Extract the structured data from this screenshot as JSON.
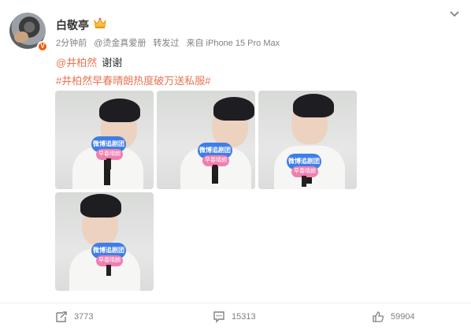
{
  "post": {
    "author": "白敬亭",
    "meta": {
      "time": "2分钟前",
      "source": "@烫金真爱册",
      "repost": "转发过",
      "device": "来自 iPhone 15 Pro Max"
    },
    "text_line1": {
      "mention": "@井柏然",
      "text": "谢谢"
    },
    "hashtag": "#井柏然早春晴朗热度破万送私服#",
    "photos": [
      {
        "sign": "微博追剧团",
        "sign2": "早春晴朗"
      },
      {
        "sign": "微博追剧团",
        "sign2": "早春晴朗"
      },
      {
        "sign": "微博追剧团",
        "sign2": "早春晴朗"
      },
      {
        "sign": "微博追剧团",
        "sign2": "早春晴朗"
      }
    ]
  },
  "actions": {
    "repost_count": "3773",
    "comment_count": "15313",
    "like_count": "59904"
  },
  "icons": {
    "verified": "V",
    "crown": "crown-icon",
    "menu": "chevron-down-icon",
    "repost": "repost-icon",
    "comment": "comment-icon",
    "like": "thumbs-up-icon"
  },
  "colors": {
    "accent": "#eb7350",
    "verified": "#f25a0a",
    "muted": "#808080"
  }
}
